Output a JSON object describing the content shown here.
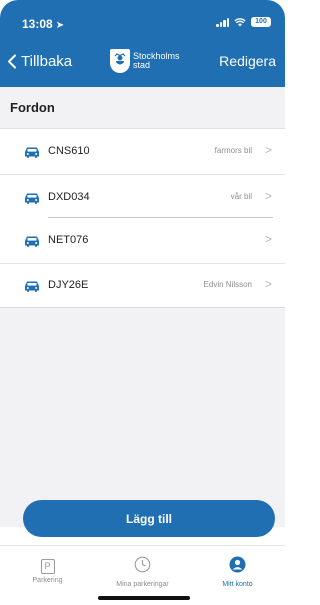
{
  "status_bar": {
    "time": "13:08",
    "battery": "100"
  },
  "nav": {
    "back_label": "Tillbaka",
    "logo_line1": "Stockholms",
    "logo_line2": "stad",
    "edit_label": "Redigera"
  },
  "section": {
    "title": "Fordon"
  },
  "vehicles": [
    {
      "plate": "CNS610",
      "description": "farmors bil"
    },
    {
      "plate": "DXD034",
      "description": "vår bil"
    },
    {
      "plate": "NET076",
      "description": ""
    },
    {
      "plate": "DJY26E",
      "description": "Edvin Nilsson"
    }
  ],
  "add_button": {
    "label": "Lägg till"
  },
  "tabbar": {
    "tabs": [
      {
        "label": "Parkering",
        "icon": "parking-icon",
        "active": false
      },
      {
        "label": "Mina parkeringar",
        "icon": "clock-icon",
        "active": false
      },
      {
        "label": "Mitt konto",
        "icon": "account-icon",
        "active": true
      }
    ]
  },
  "colors": {
    "brand": "#1f6fb2",
    "background": "#f2f2f5"
  }
}
